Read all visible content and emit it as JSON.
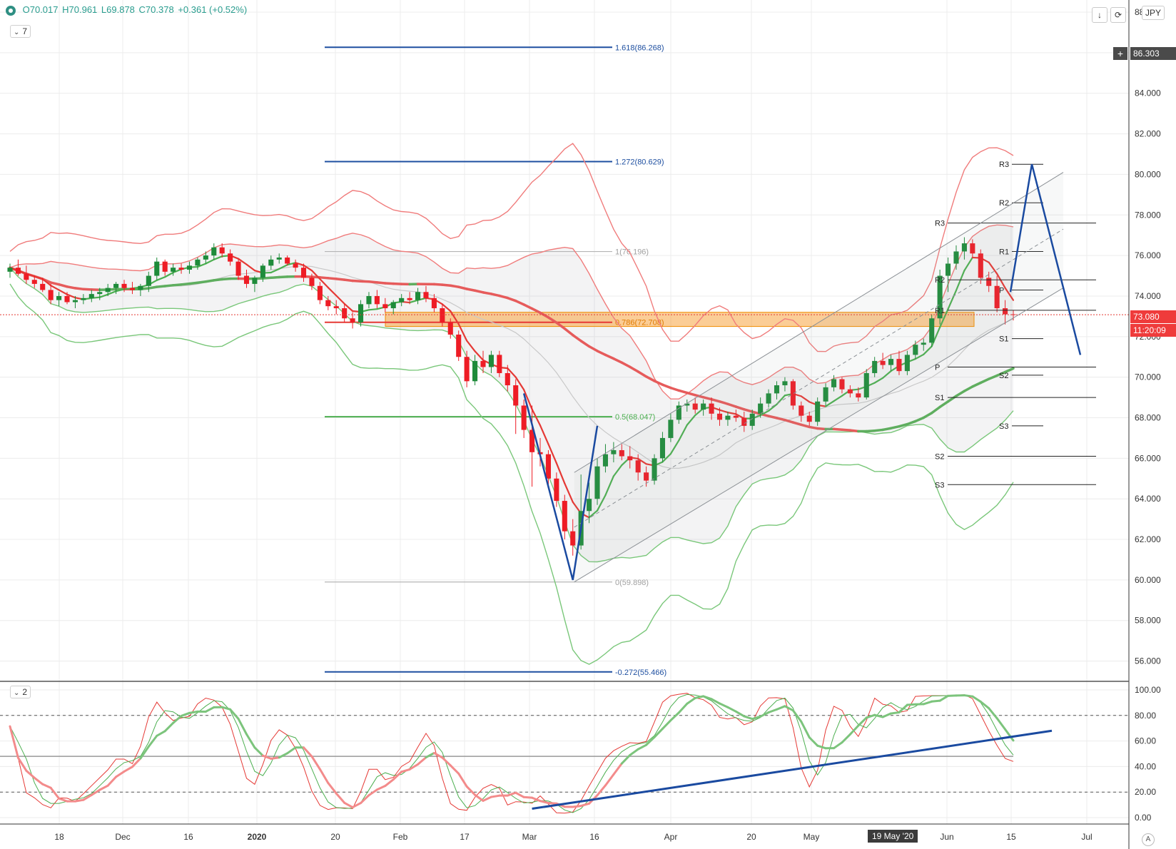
{
  "ohlc": {
    "o": "O70.017",
    "h": "H70.961",
    "l": "L69.878",
    "c": "C70.378",
    "chg": "+0.361 (+0.52%)"
  },
  "currency": "JPY",
  "panes": {
    "main_badge": "7",
    "osc_badge": "2"
  },
  "price_tags": {
    "crosshair": "86.303",
    "last": "73.080",
    "timer": "11:20:09"
  },
  "date_badge": "19 May '20",
  "corner_label": "A",
  "colors": {
    "up": "#1e8b3a",
    "down": "#ee1c25",
    "fib_blue": "#1e4fa0",
    "fib_green": "#4caf50",
    "zone": "#f7a440",
    "pivot": "#222222",
    "drawn": "#1a4aa0"
  },
  "chart_data": [
    {
      "type": "candlestick",
      "title": "",
      "y_axis": {
        "ticks": [
          "56.000",
          "58.000",
          "60.000",
          "62.000",
          "64.000",
          "66.000",
          "68.000",
          "70.000",
          "72.000",
          "74.000",
          "76.000",
          "78.000",
          "80.000",
          "82.000",
          "84.000",
          "86.000",
          "88.000"
        ],
        "range": [
          55,
          88.6
        ]
      },
      "x_axis": {
        "ticks": [
          "18",
          "Dec",
          "16",
          "2020",
          "20",
          "Feb",
          "17",
          "Mar",
          "16",
          "Apr",
          "20",
          "May",
          "Jun",
          "15",
          "Jul"
        ]
      },
      "fib_levels": [
        {
          "ratio": "1.618",
          "label": "1.618(86.268)",
          "value": 86.268
        },
        {
          "ratio": "1.272",
          "label": "1.272(80.629)",
          "value": 80.629
        },
        {
          "ratio": "1",
          "label": "1(76.196)",
          "value": 76.196
        },
        {
          "ratio": "0.786",
          "label": "0.786(72.708)",
          "value": 72.708
        },
        {
          "ratio": "0.5",
          "label": "0.5(68.047)",
          "value": 68.047
        },
        {
          "ratio": "0",
          "label": "0(59.898)",
          "value": 59.898
        },
        {
          "ratio": "-0.272",
          "label": "-0.272(55.466)",
          "value": 55.466
        }
      ],
      "pivots_weekly": [
        {
          "label": "R3",
          "value": 80.5
        },
        {
          "label": "R2",
          "value": 78.6
        },
        {
          "label": "R1",
          "value": 76.2
        },
        {
          "label": "P",
          "value": 74.3
        },
        {
          "label": "S1",
          "value": 71.9
        },
        {
          "label": "S2",
          "value": 70.1
        },
        {
          "label": "S3",
          "value": 67.6
        }
      ],
      "pivots_monthly": [
        {
          "label": "R3",
          "value": 77.6
        },
        {
          "label": "R2",
          "value": 74.8
        },
        {
          "label": "R1",
          "value": 73.3
        },
        {
          "label": "P",
          "value": 70.5
        },
        {
          "label": "S1",
          "value": 69.0
        },
        {
          "label": "S2",
          "value": 66.1
        },
        {
          "label": "S3",
          "value": 64.7
        }
      ],
      "candles_ohlc": [
        [
          75.2,
          75.6,
          74.9,
          75.4
        ],
        [
          75.4,
          75.8,
          75.0,
          75.1
        ],
        [
          75.1,
          75.5,
          74.6,
          74.8
        ],
        [
          74.8,
          75.0,
          74.4,
          74.6
        ],
        [
          74.6,
          74.9,
          74.2,
          74.3
        ],
        [
          74.3,
          74.6,
          73.6,
          73.8
        ],
        [
          73.8,
          74.2,
          73.5,
          74.0
        ],
        [
          74.0,
          74.2,
          73.6,
          73.7
        ],
        [
          73.7,
          74.0,
          73.4,
          73.8
        ],
        [
          73.8,
          74.1,
          73.6,
          73.9
        ],
        [
          73.9,
          74.3,
          73.7,
          74.1
        ],
        [
          74.1,
          74.4,
          73.8,
          74.2
        ],
        [
          74.2,
          74.6,
          74.0,
          74.4
        ],
        [
          74.4,
          74.7,
          74.1,
          74.6
        ],
        [
          74.6,
          74.8,
          74.2,
          74.4
        ],
        [
          74.4,
          74.7,
          74.1,
          74.3
        ],
        [
          74.3,
          74.6,
          74.0,
          74.5
        ],
        [
          74.5,
          75.2,
          74.2,
          75.0
        ],
        [
          75.0,
          75.9,
          74.8,
          75.7
        ],
        [
          75.7,
          75.8,
          75.0,
          75.2
        ],
        [
          75.2,
          75.6,
          75.0,
          75.4
        ],
        [
          75.4,
          75.6,
          75.1,
          75.3
        ],
        [
          75.3,
          75.7,
          75.1,
          75.5
        ],
        [
          75.5,
          75.9,
          75.3,
          75.8
        ],
        [
          75.8,
          76.2,
          75.6,
          76.0
        ],
        [
          76.0,
          76.6,
          75.8,
          76.4
        ],
        [
          76.4,
          76.6,
          75.9,
          76.1
        ],
        [
          76.1,
          76.3,
          75.5,
          75.7
        ],
        [
          75.7,
          75.8,
          74.8,
          75.0
        ],
        [
          75.0,
          75.3,
          74.4,
          74.6
        ],
        [
          74.6,
          75.0,
          74.2,
          74.9
        ],
        [
          74.9,
          75.6,
          74.7,
          75.5
        ],
        [
          75.5,
          76.0,
          75.3,
          75.8
        ],
        [
          75.8,
          76.1,
          75.6,
          75.9
        ],
        [
          75.9,
          76.0,
          75.5,
          75.6
        ],
        [
          75.6,
          75.8,
          75.2,
          75.4
        ],
        [
          75.4,
          75.6,
          74.7,
          74.9
        ],
        [
          74.9,
          75.1,
          74.3,
          74.5
        ],
        [
          74.5,
          74.7,
          73.6,
          73.8
        ],
        [
          73.8,
          74.0,
          73.3,
          73.5
        ],
        [
          73.5,
          73.8,
          73.1,
          73.4
        ],
        [
          73.4,
          73.6,
          72.7,
          72.9
        ],
        [
          72.9,
          73.2,
          72.4,
          72.7
        ],
        [
          72.7,
          73.8,
          72.5,
          73.6
        ],
        [
          73.6,
          74.2,
          73.4,
          74.0
        ],
        [
          74.0,
          74.3,
          73.4,
          73.6
        ],
        [
          73.6,
          73.9,
          73.2,
          73.4
        ],
        [
          73.4,
          73.8,
          73.1,
          73.7
        ],
        [
          73.7,
          74.1,
          73.5,
          73.9
        ],
        [
          73.9,
          74.2,
          73.6,
          73.8
        ],
        [
          73.8,
          74.4,
          73.6,
          74.2
        ],
        [
          74.2,
          74.5,
          73.7,
          73.9
        ],
        [
          73.9,
          74.1,
          73.2,
          73.4
        ],
        [
          73.4,
          73.6,
          72.5,
          72.7
        ],
        [
          72.7,
          72.9,
          71.9,
          72.1
        ],
        [
          72.1,
          72.3,
          70.8,
          71.0
        ],
        [
          71.0,
          71.3,
          69.5,
          69.8
        ],
        [
          69.8,
          71.1,
          69.6,
          70.8
        ],
        [
          70.8,
          71.3,
          70.2,
          70.5
        ],
        [
          70.5,
          71.3,
          70.2,
          71.1
        ],
        [
          71.1,
          71.3,
          70.0,
          70.2
        ],
        [
          70.2,
          70.6,
          69.3,
          69.6
        ],
        [
          69.6,
          69.9,
          67.2,
          68.6
        ],
        [
          68.6,
          68.9,
          67.0,
          67.4
        ],
        [
          67.4,
          68.6,
          64.6,
          66.3
        ],
        [
          66.3,
          67.0,
          65.6,
          66.2
        ],
        [
          66.2,
          66.4,
          64.7,
          65.0
        ],
        [
          65.0,
          65.3,
          63.6,
          63.9
        ],
        [
          63.9,
          64.2,
          62.0,
          62.4
        ],
        [
          62.4,
          63.0,
          61.2,
          61.7
        ],
        [
          61.7,
          65.2,
          61.5,
          63.4
        ],
        [
          63.4,
          64.8,
          62.8,
          64.0
        ],
        [
          64.0,
          66.0,
          63.7,
          65.6
        ],
        [
          65.6,
          66.7,
          65.3,
          66.2
        ],
        [
          66.2,
          66.8,
          65.8,
          66.4
        ],
        [
          66.4,
          66.7,
          65.9,
          66.1
        ],
        [
          66.1,
          66.6,
          65.5,
          65.9
        ],
        [
          65.9,
          66.2,
          64.9,
          65.3
        ],
        [
          65.3,
          65.6,
          64.6,
          64.9
        ],
        [
          64.9,
          66.2,
          64.7,
          66.0
        ],
        [
          66.0,
          67.3,
          65.8,
          67.0
        ],
        [
          67.0,
          68.2,
          66.8,
          67.9
        ],
        [
          67.9,
          68.8,
          67.7,
          68.6
        ],
        [
          68.6,
          68.9,
          68.3,
          68.7
        ],
        [
          68.7,
          69.0,
          68.2,
          68.4
        ],
        [
          68.4,
          68.9,
          68.1,
          68.7
        ],
        [
          68.7,
          69.0,
          67.9,
          68.2
        ],
        [
          68.2,
          68.5,
          67.6,
          67.9
        ],
        [
          67.9,
          68.3,
          67.6,
          68.1
        ],
        [
          68.1,
          68.4,
          67.8,
          68.0
        ],
        [
          68.0,
          68.3,
          67.3,
          67.6
        ],
        [
          67.6,
          68.4,
          67.4,
          68.2
        ],
        [
          68.2,
          69.0,
          68.0,
          68.7
        ],
        [
          68.7,
          69.4,
          68.5,
          69.2
        ],
        [
          69.2,
          69.8,
          68.9,
          69.6
        ],
        [
          69.6,
          70.0,
          69.3,
          69.8
        ],
        [
          69.8,
          69.9,
          68.4,
          68.6
        ],
        [
          68.6,
          68.8,
          67.8,
          68.1
        ],
        [
          68.1,
          68.3,
          67.6,
          67.8
        ],
        [
          67.8,
          69.0,
          67.6,
          68.8
        ],
        [
          68.8,
          69.7,
          68.6,
          69.5
        ],
        [
          69.5,
          70.1,
          69.3,
          69.9
        ],
        [
          69.9,
          70.0,
          69.2,
          69.4
        ],
        [
          69.4,
          69.6,
          69.0,
          69.2
        ],
        [
          69.2,
          69.5,
          68.8,
          69.0
        ],
        [
          69.0,
          70.4,
          68.9,
          70.2
        ],
        [
          70.2,
          71.0,
          70.0,
          70.8
        ],
        [
          70.8,
          71.2,
          70.4,
          70.6
        ],
        [
          70.6,
          71.1,
          70.3,
          70.9
        ],
        [
          70.9,
          71.3,
          70.1,
          70.3
        ],
        [
          70.3,
          71.3,
          70.1,
          71.1
        ],
        [
          71.1,
          71.8,
          70.9,
          71.6
        ],
        [
          71.6,
          71.9,
          71.3,
          71.7
        ],
        [
          71.7,
          73.1,
          71.5,
          72.9
        ],
        [
          72.9,
          75.3,
          72.6,
          75.0
        ],
        [
          75.0,
          75.9,
          74.2,
          75.6
        ],
        [
          75.6,
          76.5,
          75.3,
          76.2
        ],
        [
          76.2,
          76.9,
          75.8,
          76.6
        ],
        [
          76.6,
          76.8,
          75.9,
          76.1
        ],
        [
          76.1,
          76.3,
          74.6,
          74.9
        ],
        [
          74.9,
          75.2,
          74.2,
          74.5
        ],
        [
          74.5,
          75.0,
          73.2,
          73.4
        ],
        [
          73.4,
          73.8,
          72.6,
          73.1
        ],
        [
          73.1,
          73.3,
          72.8,
          73.08
        ]
      ]
    },
    {
      "type": "line",
      "title": "",
      "y_axis": {
        "ticks": [
          "0.00",
          "20.00",
          "40.00",
          "60.00",
          "80.00",
          "100.00"
        ],
        "range": [
          -5,
          105
        ]
      },
      "bands": [
        80,
        20
      ],
      "midline": 48
    }
  ]
}
